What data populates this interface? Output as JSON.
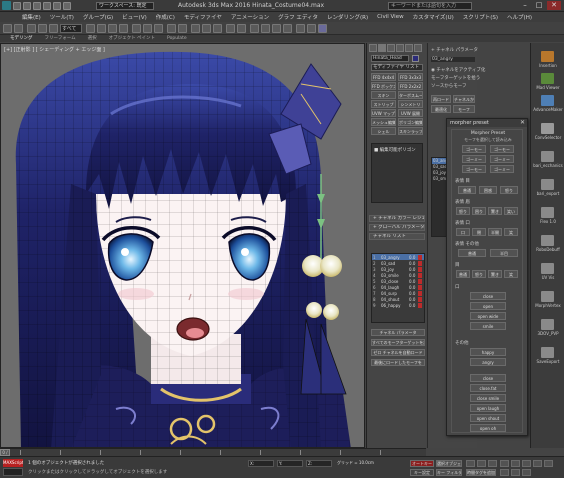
{
  "window": {
    "title": "Autodesk 3ds Max 2016   Hinata_Costume04.max",
    "workspace": "ワークスペース: 既定",
    "search_placeholder": "キーワードまたは語句を入力",
    "controls": [
      "–",
      "□",
      "✕"
    ]
  },
  "menu": [
    "編集(E)",
    "ツール(T)",
    "グループ(G)",
    "ビュー(V)",
    "作成(C)",
    "モディファイヤ",
    "アニメーション",
    "グラフ エディタ",
    "レンダリング(R)",
    "Civil View",
    "カスタマイズ(U)",
    "スクリプト(S)",
    "ヘルプ(H)"
  ],
  "toolbar": {
    "selection_set": "すべて"
  },
  "ribbon": {
    "tabs": [
      "モデリング",
      "フリーフォーム",
      "選択",
      "オブジェクト ペイント",
      "Populate"
    ],
    "active": 0
  },
  "viewport": {
    "label": "[+] [正射影 ] [ シェーディング + エッジ面 ]"
  },
  "command_panel": {
    "object_name": "Hinata_Head",
    "modifier_list": "モディファイヤ リスト",
    "buttons": [
      "FFD 4x4x4",
      "FFD 3x3x3",
      "FFD ボックス",
      "FFD 2x2x2",
      "スキン",
      "ターボスムーズ",
      "ストリップ",
      "シンメトリ",
      "UVW マップ",
      "UVW 展開",
      "メッシュ編集",
      "ポリゴン編集",
      "シェル",
      "スキンラップ",
      "UVW マップクリア",
      "ポイントキャッシュ"
    ],
    "stack_item": "■ 編集可能ポリゴン",
    "rollouts": [
      "+ チャネル カラー レジェンド",
      "+ グローバル パラメータ",
      "チャネル リスト"
    ],
    "channels": [
      {
        "num": "1",
        "name": "03_angry",
        "val": "0.0"
      },
      {
        "num": "2",
        "name": "03_sad",
        "val": "0.0"
      },
      {
        "num": "3",
        "name": "03_joy",
        "val": "0.0"
      },
      {
        "num": "4",
        "name": "03_smile",
        "val": "0.0"
      },
      {
        "num": "5",
        "name": "03_close",
        "val": "0.0"
      },
      {
        "num": "6",
        "name": "04_laugh",
        "val": "0.0"
      },
      {
        "num": "7",
        "name": "04_surp",
        "val": "0.0"
      },
      {
        "num": "8",
        "name": "04_shout",
        "val": "0.0"
      },
      {
        "num": "9",
        "name": "06_happy",
        "val": "0.0"
      }
    ],
    "side_buttons": [
      "チャネル パラメータ",
      "すべてのモーフターゲットを読み込み",
      "ゼロ チャネルを自動ロード",
      "最後にロードしたモーフを"
    ]
  },
  "panel2": {
    "lines": [
      "+ チャネル パラメータ",
      "03_angry",
      "◉ チャネルをアクティブ化",
      "モーフターゲットを拾う",
      "ソースからモーフ"
    ],
    "buttons": [
      "再ロード",
      "チャネルから抽出",
      "最適化",
      "モーフ"
    ],
    "list": [
      "03_angry",
      "03_sad",
      "03_joy",
      "03_smile"
    ]
  },
  "morpher": {
    "title": "morpher preset",
    "header": "Morpher Preset",
    "sub": "モーフを選択して読み込み",
    "groups": [
      "表情 目",
      "表情 眉",
      "表情 口",
      "表情 その他",
      "目",
      "口",
      "その他"
    ],
    "buttons": [
      "ゴーモー",
      "ゴーモー",
      "ゴーミー",
      "ゴーミー",
      "ゴーモー",
      "ゴーミー",
      "普通",
      "困惑",
      "怒り",
      "怒り",
      "困り",
      "驚き",
      "笑い",
      "口",
      "閉",
      "半開",
      "笑",
      "普通",
      "半目",
      "普通",
      "怒り",
      "驚き",
      "笑",
      "close",
      "open",
      "open wide",
      "smile",
      "happy",
      "angry",
      "close",
      "close.fat",
      "close smile",
      "open laugh",
      "open shout",
      "open oh"
    ]
  },
  "right_strip": [
    "Insertion",
    "Mad Viewer",
    "AdvanceMaker",
    "ConvSelector",
    "bari_ecchanics",
    "bari_export",
    "Flex 1.0",
    "RoboDebuff",
    "UV Vis",
    "MorphVertex",
    "3DOV_PVP",
    "SaveExport"
  ],
  "timeline": {
    "frame": "0 / 100"
  },
  "status": {
    "maxscript": "MAXScript",
    "line1": "1 個のオブジェクトが選択されました",
    "line2": "クリックまたはクリックしてドラッグしてオブジェクトを選択します",
    "x": "X:",
    "y": "Y:",
    "z": "Z:",
    "grid": "グリッド = 10.0cm",
    "autokey": "オートキー",
    "setkey": "キー設定",
    "selected": "選択オブジェクト",
    "keyfilter": "キー フィルタ...",
    "addtime": "時間タグを追加"
  },
  "colors": {
    "accent": "#4a6fa5",
    "autokey": "#8b1f1f",
    "maxscript": "#b82121"
  }
}
